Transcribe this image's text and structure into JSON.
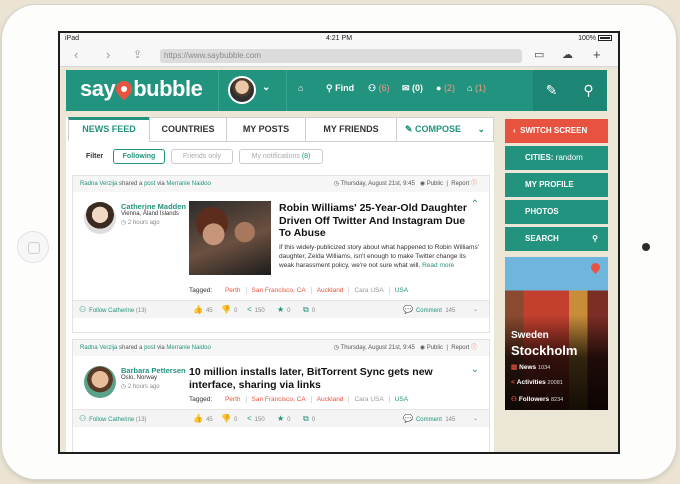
{
  "status": {
    "left": "iPad",
    "time": "4:21 PM",
    "battery": "100%"
  },
  "browser": {
    "url": "https://www.saybubble.com"
  },
  "app": {
    "logo_left": "say",
    "logo_right": "bubble"
  },
  "nav": {
    "home_label": "",
    "find": "Find",
    "friends_count": "(6)",
    "messages_count": "(0)",
    "alerts_count": "(2)",
    "groups_count": "(1)"
  },
  "tabs": [
    {
      "label": "NEWS FEED"
    },
    {
      "label": "COUNTRIES"
    },
    {
      "label": "MY POSTS"
    },
    {
      "label": "MY FRIENDS"
    },
    {
      "label": "COMPOSE"
    }
  ],
  "filter": {
    "label": "Filter",
    "following": "Following",
    "friends_only": "Friends only",
    "notifications": "My notifications",
    "notifications_count": "(8)"
  },
  "posts": [
    {
      "shared_by": "Radna Verzija",
      "shared_mid": "shared a",
      "shared_obj": "post",
      "via": "via",
      "via_name": "Merranie Naidoo",
      "date": "Thursday, August 21st, 9:45",
      "visibility": "Public",
      "report": "Report",
      "author": "Catherine Madden",
      "location": "Vienna, Åland Islands",
      "time": "2 hours ago",
      "title": "Robin Williams' 25-Year-Old Daughter Driven Off Twitter And Instagram Due To Abuse",
      "body": "If this widely-publicized story about what happened to Robin Williams' daughter, Zelda Williams, isn't enough to make Twitter change its weak harassment policy, we're not sure what will.",
      "read_more": "Read more",
      "tagged_label": "Tagged:",
      "tags": [
        "Perth",
        "San Francisco, CA",
        "Auckland",
        "Cara USA",
        "USA"
      ],
      "follow": "Follow Catherine",
      "follow_count": "(13)",
      "likes": "45",
      "dislikes": "0",
      "shares": "150",
      "stars": "0",
      "edits": "0",
      "comment": "Comment",
      "comment_count": "145"
    },
    {
      "shared_by": "Radna Verzija",
      "shared_mid": "shared a",
      "shared_obj": "post",
      "via": "via",
      "via_name": "Merranie Naidoo",
      "date": "Thursday, August 21st, 9:45",
      "visibility": "Public",
      "report": "Report",
      "author": "Barbara Pettersen",
      "location": "Oslo, Norway",
      "time": "2 hours ago",
      "title": "10 million installs later, BitTorrent Sync gets new interface, sharing via links",
      "tagged_label": "Tagged:",
      "tags": [
        "Perth",
        "San Francisco, CA",
        "Auckland",
        "Cara USA",
        "USA"
      ],
      "follow": "Follow Catherine",
      "follow_count": "(13)",
      "likes": "45",
      "dislikes": "0",
      "shares": "150",
      "stars": "0",
      "edits": "0",
      "comment": "Comment",
      "comment_count": "145"
    }
  ],
  "sidebar": {
    "switch_screen": "SWITCH SCREEN",
    "cities_label": "CITIES:",
    "cities_value": "random",
    "my_profile": "MY PROFILE",
    "photos": "PHOTOS",
    "search": "SEARCH",
    "city": {
      "country": "Sweden",
      "name": "Stockholm",
      "news_label": "News",
      "news": "1034",
      "activities_label": "Activities",
      "activities": "20081",
      "followers_label": "Followers",
      "followers": "8234"
    }
  },
  "colors": {
    "brand": "#22937e",
    "accent": "#e8533f"
  }
}
